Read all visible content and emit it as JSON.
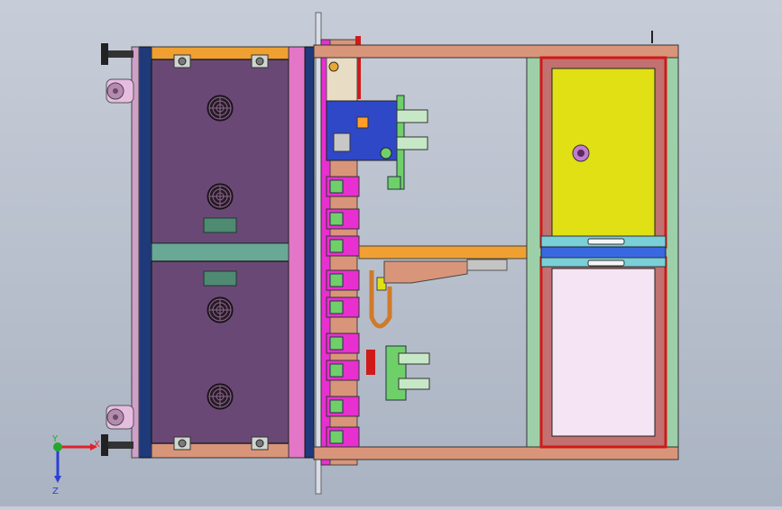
{
  "viewport": {
    "background_top": "#c7cdd8",
    "background_bottom": "#aab3c2"
  },
  "triad": {
    "x_label": "X",
    "y_label": "Y",
    "z_label": "Z",
    "x_color": "#e0202a",
    "y_color": "#22a82a",
    "z_color": "#2a3fd8"
  },
  "colors": {
    "frame_salmon": "#d9957a",
    "cabinet_purple": "#6a4876",
    "cabinet_border": "#2b2b2b",
    "panel_navy": "#1f3a7a",
    "teal_bar": "#6aa896",
    "pink_rail": "#e476c8",
    "magenta": "#e82fd0",
    "yellow_panel": "#e0e014",
    "pink_panel": "#f5e4f4",
    "red_frame": "#d01a1a",
    "blue_board": "#2f48c8",
    "orange_bar": "#f0a030",
    "green_trim": "#6fd06a",
    "cyan_trim": "#7ad0d8",
    "blue_mid": "#3a68e0"
  },
  "icons": {
    "fan": "fan-icon",
    "caster": "caster-wheel-icon",
    "foot": "leveling-foot-icon",
    "screw": "screw-head-icon",
    "knob": "rotary-knob-icon"
  }
}
